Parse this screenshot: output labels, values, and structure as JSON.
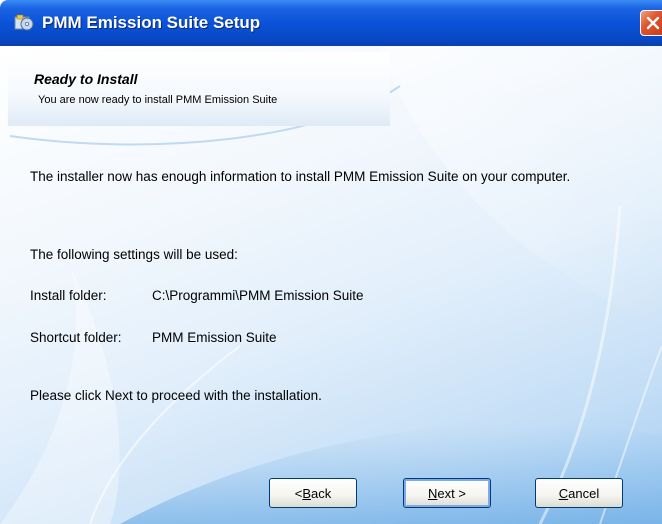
{
  "window": {
    "title": "PMM Emission Suite Setup"
  },
  "header": {
    "title": "Ready to Install",
    "subtitle": "You are now ready to install PMM Emission Suite"
  },
  "body": {
    "intro": "The installer now has enough information to install PMM Emission Suite on your computer.",
    "settings_heading": "The following settings will be used:",
    "install_folder_label": "Install folder:",
    "install_folder_value": "C:\\Programmi\\PMM Emission Suite",
    "shortcut_folder_label": "Shortcut folder:",
    "shortcut_folder_value": "PMM Emission Suite",
    "instruction": "Please click Next to proceed with the installation."
  },
  "buttons": {
    "back_prefix": "< ",
    "back_mnemonic": "B",
    "back_rest": "ack",
    "next_mnemonic": "N",
    "next_rest": "ext >",
    "cancel_mnemonic": "C",
    "cancel_rest": "ancel"
  },
  "colors": {
    "titlebar": "#0a52d8",
    "close": "#e0562c"
  },
  "icons": {
    "app": "installer-disc-icon",
    "close": "close-icon"
  }
}
